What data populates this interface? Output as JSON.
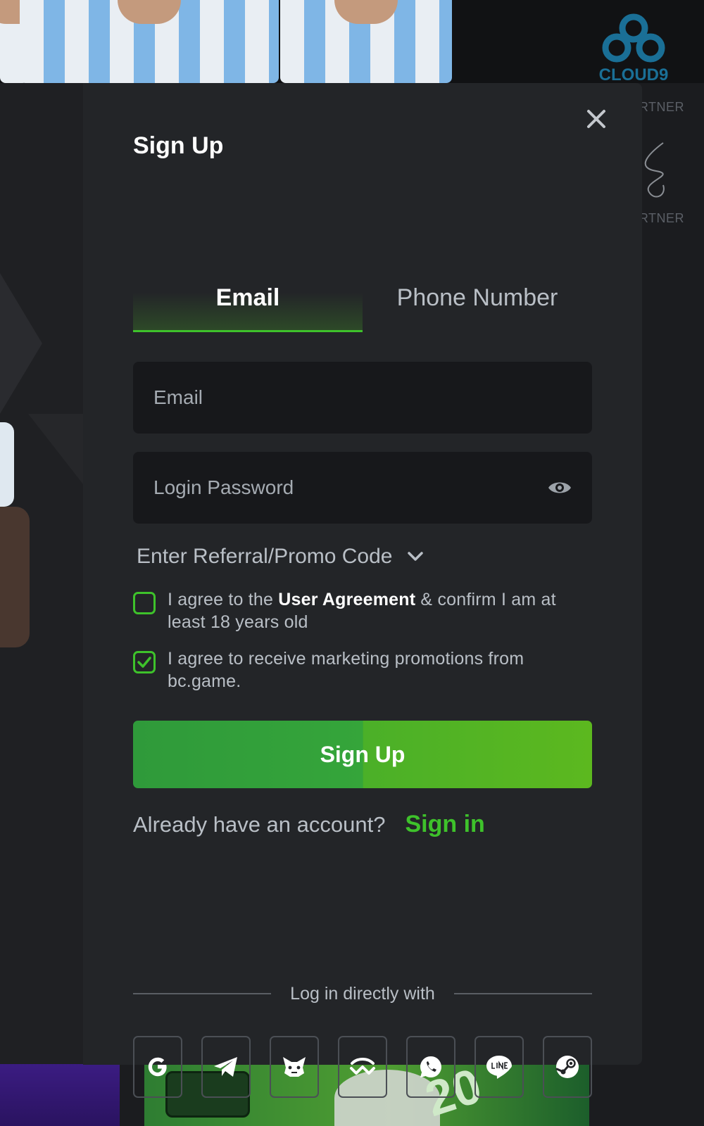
{
  "background": {
    "partner_labels": [
      "RTNER",
      "RTNER"
    ],
    "logo_text": "CLOUD9",
    "promo_number": "20"
  },
  "modal": {
    "title": "Sign Up",
    "tabs": [
      {
        "label": "Email",
        "active": true
      },
      {
        "label": "Phone Number",
        "active": false
      }
    ],
    "email_field": {
      "placeholder": "Email",
      "value": ""
    },
    "password_field": {
      "placeholder": "Login Password",
      "value": ""
    },
    "promo_code_toggle": "Enter Referral/Promo Code",
    "checkboxes": [
      {
        "checked": false,
        "text_before": "I agree to the ",
        "link": "User Agreement",
        "text_after": " & confirm I am at least 18 years old"
      },
      {
        "checked": true,
        "text": "I agree to receive marketing promotions from bc.game."
      }
    ],
    "submit_label": "Sign Up",
    "already_text": "Already have an account?",
    "sign_in_label": "Sign in",
    "divider_text": "Log in directly with",
    "social_logins": [
      "google-icon",
      "telegram-icon",
      "metamask-icon",
      "walletconnect-icon",
      "whatsapp-icon",
      "line-icon",
      "steam-icon"
    ]
  },
  "colors": {
    "accent_green": "#3ec22b",
    "modal_bg": "#232528",
    "input_bg": "#17181b"
  }
}
